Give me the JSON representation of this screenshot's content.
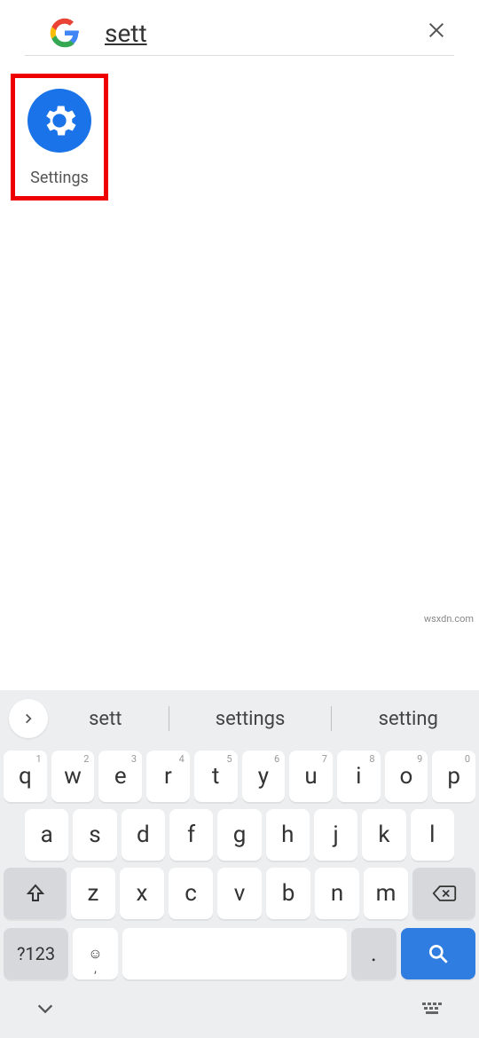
{
  "search": {
    "query": "sett"
  },
  "result": {
    "label": "Settings"
  },
  "keyboard": {
    "suggestions": [
      "sett",
      "settings",
      "setting"
    ],
    "row1": [
      {
        "k": "q",
        "h": "1"
      },
      {
        "k": "w",
        "h": "2"
      },
      {
        "k": "e",
        "h": "3"
      },
      {
        "k": "r",
        "h": "4"
      },
      {
        "k": "t",
        "h": "5"
      },
      {
        "k": "y",
        "h": "6"
      },
      {
        "k": "u",
        "h": "7"
      },
      {
        "k": "i",
        "h": "8"
      },
      {
        "k": "o",
        "h": "9"
      },
      {
        "k": "p",
        "h": "0"
      }
    ],
    "row2": [
      "a",
      "s",
      "d",
      "f",
      "g",
      "h",
      "j",
      "k",
      "l"
    ],
    "row3": [
      "z",
      "x",
      "c",
      "v",
      "b",
      "n",
      "m"
    ],
    "symbols_label": "?123",
    "emoji_sub": ",",
    "period": "."
  },
  "watermark": "wsxdn.com"
}
